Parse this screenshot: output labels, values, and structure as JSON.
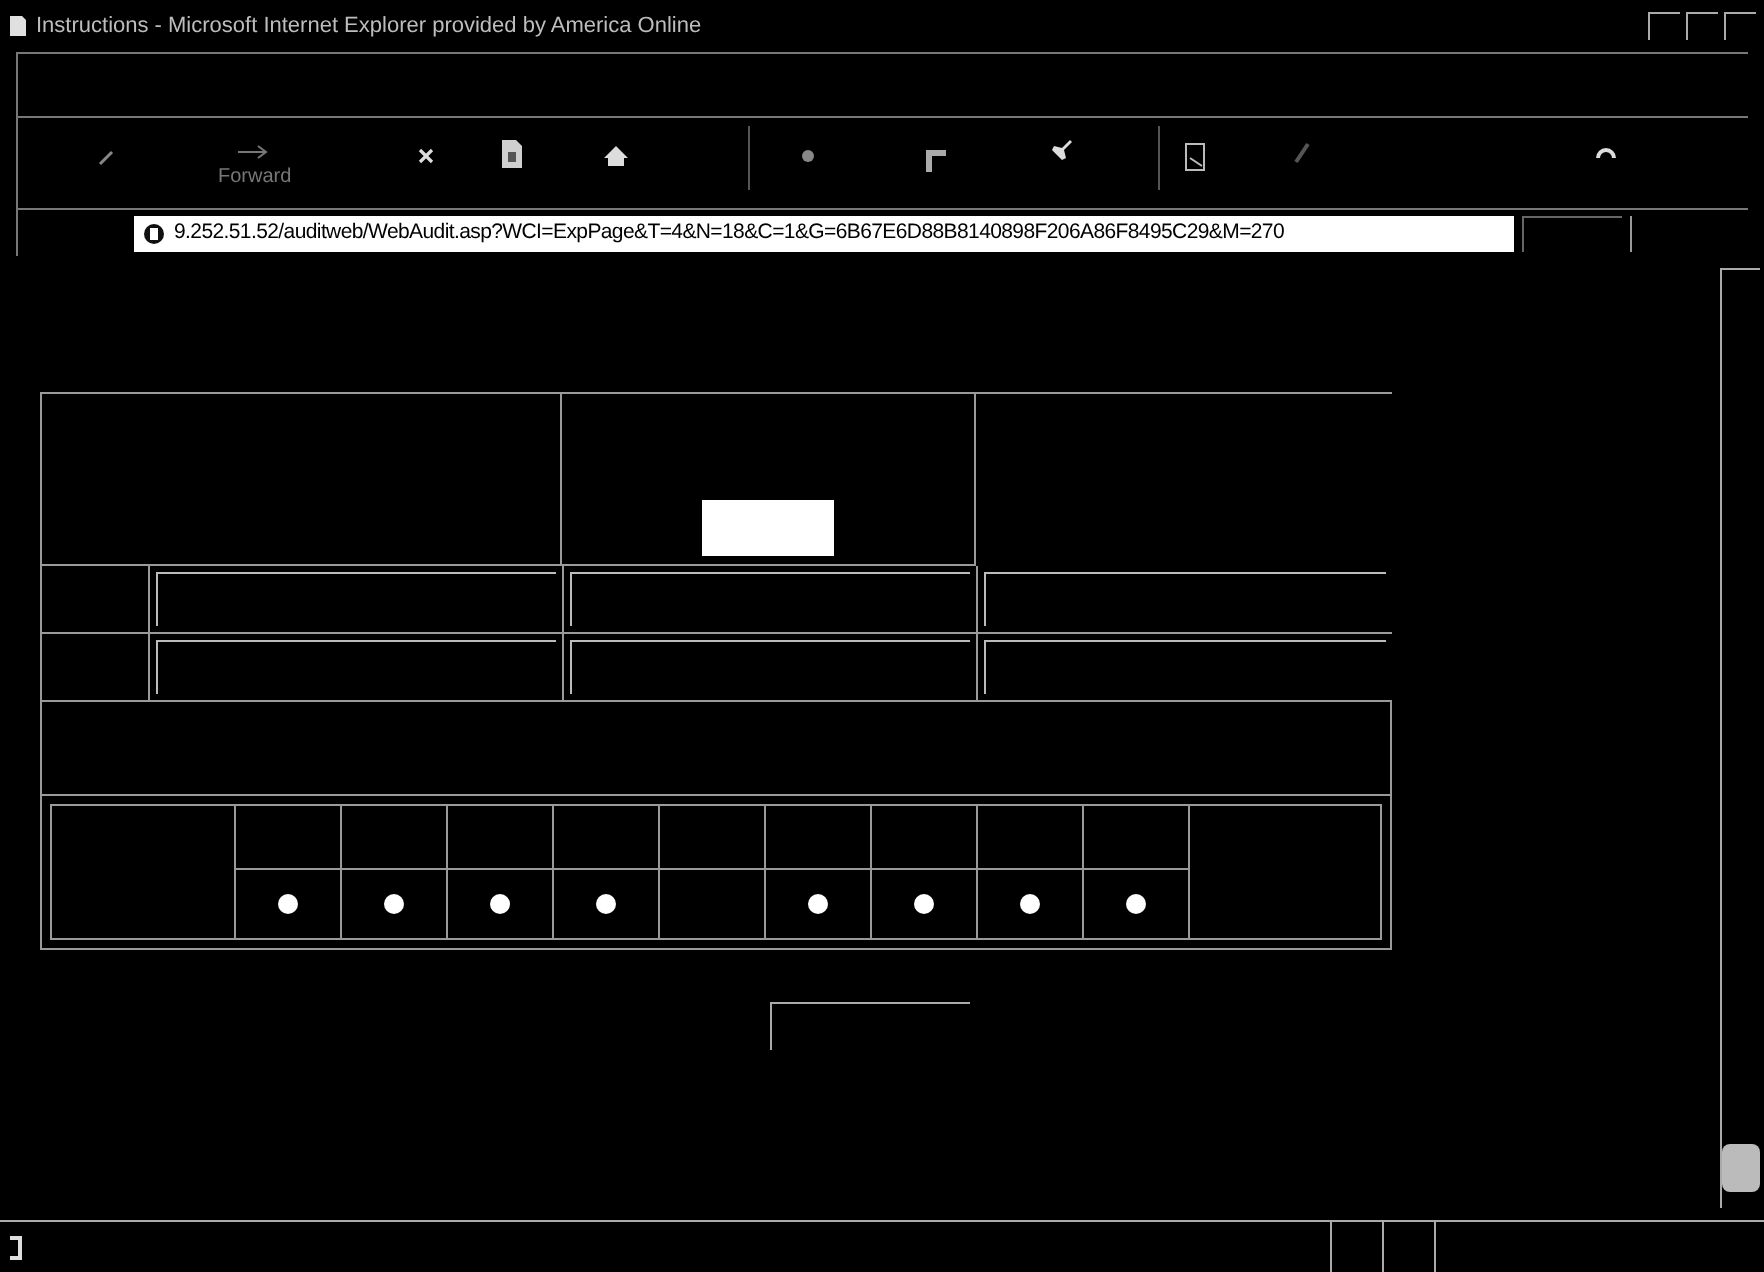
{
  "window": {
    "title": "Instructions - Microsoft Internet Explorer provided by America Online"
  },
  "toolbar": {
    "forward_label": "Forward"
  },
  "address_bar": {
    "value": "9.252.51.52/auditweb/WebAudit.asp?WCI=ExpPage&T=4&N=18&C=1&G=6B67E6D88B8140898F206A86F8495C29&M=270"
  },
  "rating_row": [
    {
      "kind": "radio"
    },
    {
      "kind": "radio"
    },
    {
      "kind": "radio"
    },
    {
      "kind": "radio"
    },
    {
      "kind": "empty"
    },
    {
      "kind": "radio"
    },
    {
      "kind": "radio"
    },
    {
      "kind": "radio"
    },
    {
      "kind": "radio"
    }
  ]
}
